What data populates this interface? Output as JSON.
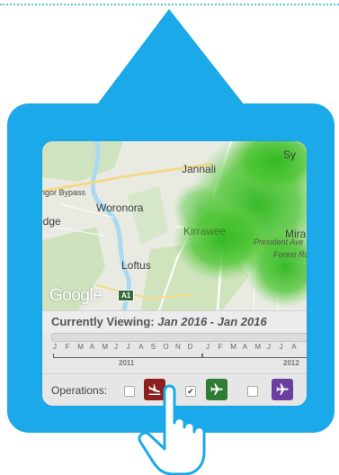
{
  "colors": {
    "frame": "#1ba9ea",
    "dotted_line": "#5bbfe8",
    "heat_green": "#43c62c",
    "arrivals_button": "#8e1f1f",
    "departures_button": "#2e7d32",
    "overflights_button": "#6a3fa0"
  },
  "map": {
    "labels": {
      "sy": "Sy",
      "jannali": "Jannali",
      "bypass": "ngor Bypass",
      "woronora": "Woronora",
      "ridge": "idge",
      "kirrawee": "Kirrawee",
      "mira": "Mira",
      "president_ave": "President Ave",
      "forest_rd": "Forest Rd",
      "loftus": "Loftus",
      "road_shield": "A1"
    },
    "logo_text": "Google"
  },
  "viewing": {
    "label": "Currently Viewing:",
    "range": "Jan 2016 - Jan 2016"
  },
  "timeline": {
    "months_2011": [
      "J",
      "F",
      "M",
      "A",
      "M",
      "J",
      "J",
      "A",
      "S",
      "O",
      "N",
      "D"
    ],
    "months_2012": [
      "J",
      "F",
      "M",
      "A",
      "M",
      "J",
      "J",
      "A"
    ],
    "year_2011": "2011",
    "year_2012": "2012"
  },
  "operations": {
    "label": "Operations:",
    "items": [
      {
        "name": "arrivals",
        "icon": "plane-landing-icon",
        "checked": false,
        "check_mark": ""
      },
      {
        "name": "departures",
        "icon": "plane-icon",
        "checked": true,
        "check_mark": "✔"
      },
      {
        "name": "overflights",
        "icon": "plane-icon",
        "checked": false,
        "check_mark": ""
      }
    ]
  },
  "cursor": {
    "icon": "pointing-hand-icon"
  }
}
